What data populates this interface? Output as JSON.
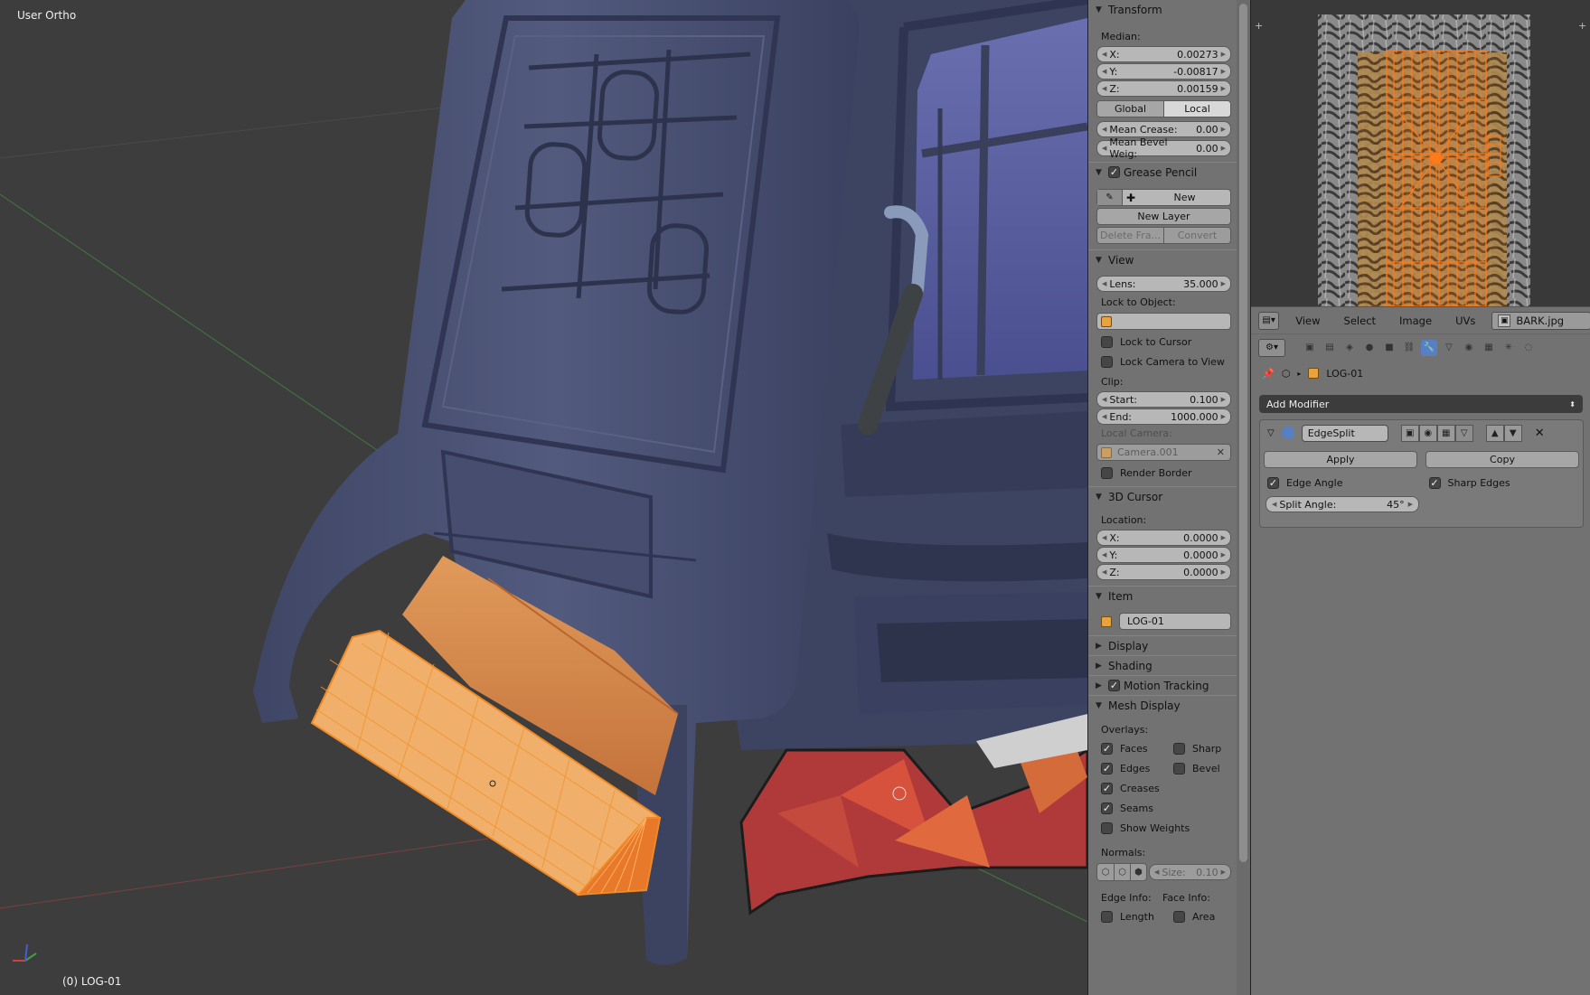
{
  "viewport": {
    "view_label": "User Ortho",
    "object_label": "(0) LOG-01"
  },
  "npanel": {
    "transform": {
      "title": "Transform",
      "median_label": "Median:",
      "x_label": "X:",
      "x_value": "0.00273",
      "y_label": "Y:",
      "y_value": "-0.00817",
      "z_label": "Z:",
      "z_value": "0.00159",
      "global_label": "Global",
      "local_label": "Local",
      "mean_crease_label": "Mean Crease:",
      "mean_crease_value": "0.00",
      "mean_bevel_label": "Mean Bevel Weig:",
      "mean_bevel_value": "0.00"
    },
    "grease_pencil": {
      "title": "Grease Pencil",
      "new_label": "New",
      "new_layer_label": "New Layer",
      "delete_frame_label": "Delete Fra...",
      "convert_label": "Convert"
    },
    "view": {
      "title": "View",
      "lens_label": "Lens:",
      "lens_value": "35.000",
      "lock_to_object_label": "Lock to Object:",
      "lock_to_cursor_label": "Lock to Cursor",
      "lock_camera_label": "Lock Camera to View",
      "clip_label": "Clip:",
      "start_label": "Start:",
      "start_value": "0.100",
      "end_label": "End:",
      "end_value": "1000.000",
      "local_camera_label": "Local Camera:",
      "camera_value": "Camera.001",
      "render_border_label": "Render Border"
    },
    "cursor": {
      "title": "3D Cursor",
      "location_label": "Location:",
      "x_label": "X:",
      "x_value": "0.0000",
      "y_label": "Y:",
      "y_value": "0.0000",
      "z_label": "Z:",
      "z_value": "0.0000"
    },
    "item": {
      "title": "Item",
      "name_value": "LOG-01"
    },
    "display": {
      "title": "Display"
    },
    "shading": {
      "title": "Shading"
    },
    "motion_tracking": {
      "title": "Motion Tracking"
    },
    "mesh_display": {
      "title": "Mesh Display",
      "overlays_label": "Overlays:",
      "faces_label": "Faces",
      "sharp_label": "Sharp",
      "edges_label": "Edges",
      "bevel_label": "Bevel",
      "creases_label": "Creases",
      "seams_label": "Seams",
      "show_weights_label": "Show Weights",
      "normals_label": "Normals:",
      "size_label": "Size:",
      "size_value": "0.10",
      "edge_info_label": "Edge Info:",
      "face_info_label": "Face Info:",
      "length_label": "Length",
      "area_label": "Area"
    }
  },
  "image_editor": {
    "menu": [
      "View",
      "Select",
      "Image",
      "UVs"
    ],
    "image_name": "BARK.jpg"
  },
  "properties": {
    "object_name": "LOG-01",
    "add_modifier_label": "Add Modifier",
    "modifier": {
      "name": "EdgeSplit",
      "apply_label": "Apply",
      "copy_label": "Copy",
      "edge_angle_label": "Edge Angle",
      "sharp_edges_label": "Sharp Edges",
      "split_angle_label": "Split Angle:",
      "split_angle_value": "45°"
    }
  },
  "colors": {
    "selection_orange": "#f08a24",
    "stove_blue": "#4a5277",
    "active_blue": "#5680c2"
  }
}
